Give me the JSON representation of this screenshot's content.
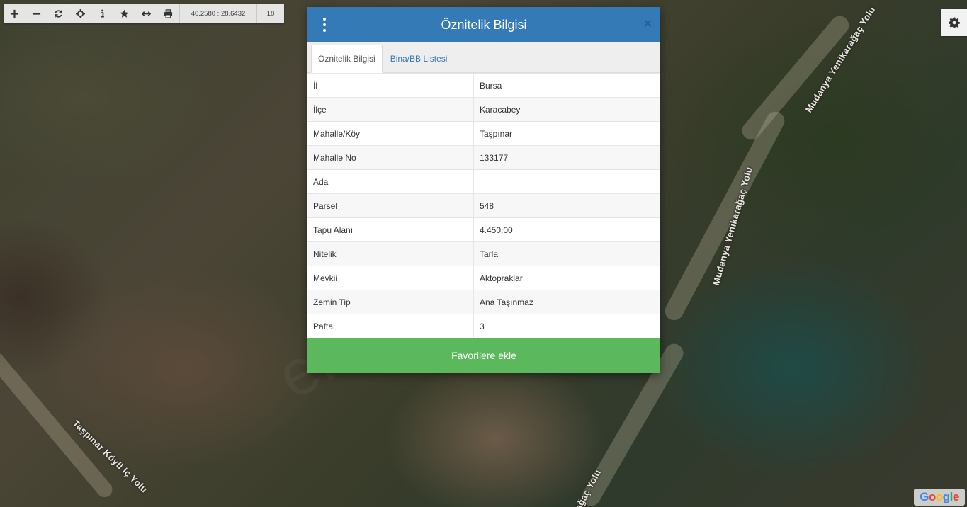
{
  "toolbar": {
    "coordinates": "40.2580 : 28.6432",
    "zoom_level": "18",
    "buttons": [
      "zoom-in-icon",
      "zoom-out-icon",
      "refresh-icon",
      "locate-icon",
      "info-icon",
      "star-icon",
      "measure-icon",
      "print-icon"
    ]
  },
  "map": {
    "road_labels": [
      "Mudanya Yenikarağaç Yolu",
      "Mudanya Yenikarağaç Yolu",
      "Taşpınar Köyü İç Yolu",
      "ağaç Yolu"
    ],
    "logo": "Google"
  },
  "modal": {
    "title": "Öznitelik Bilgisi",
    "close_label": "×",
    "tabs": [
      "Öznitelik Bilgisi",
      "Bina/BB Listesi"
    ],
    "rows": [
      {
        "key": "İl",
        "value": "Bursa"
      },
      {
        "key": "İlçe",
        "value": "Karacabey"
      },
      {
        "key": "Mahalle/Köy",
        "value": "Taşpınar"
      },
      {
        "key": "Mahalle No",
        "value": "133177"
      },
      {
        "key": "Ada",
        "value": ""
      },
      {
        "key": "Parsel",
        "value": "548"
      },
      {
        "key": "Tapu Alanı",
        "value": "4.450,00"
      },
      {
        "key": "Nitelik",
        "value": "Tarla"
      },
      {
        "key": "Mevkii",
        "value": "Aktopraklar"
      },
      {
        "key": "Zemin Tip",
        "value": "Ana Taşınmaz"
      },
      {
        "key": "Pafta",
        "value": "3"
      }
    ],
    "favorite_button": "Favorilere ekle"
  },
  "watermark": "emlakjet.com",
  "colors": {
    "header": "#337ab7",
    "favorite": "#5cb85c",
    "tab_link": "#337ab7"
  }
}
